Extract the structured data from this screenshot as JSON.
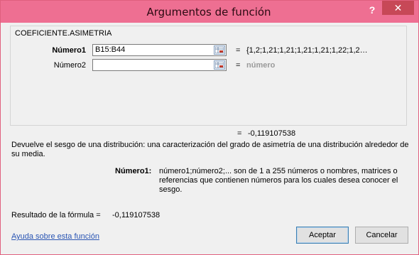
{
  "window": {
    "title": "Argumentos de función",
    "help_glyph": "?",
    "close_glyph": "✕"
  },
  "function": {
    "name": "COEFICIENTE.ASIMETRIA"
  },
  "args": [
    {
      "label": "Número1",
      "value": "B15:B44",
      "eq": "=",
      "preview": "{1,2;1,21;1,21;1,21;1,21;1,22;1,2…"
    },
    {
      "label": "Número2",
      "value": "",
      "eq": "=",
      "preview": "número"
    }
  ],
  "result": {
    "eq": "=",
    "value": "-0,119107538"
  },
  "description": "Devuelve el sesgo de una distribución: una caracterización del grado de asimetría de una distribución alrededor de su media.",
  "arg_help": {
    "label": "Número1:",
    "text": "número1;número2;... son de 1 a 255 números o nombres, matrices o referencias que contienen números para los cuales desea conocer el sesgo."
  },
  "formula_result": {
    "label": "Resultado de la fórmula =",
    "value": "-0,119107538"
  },
  "footer": {
    "help_link": "Ayuda sobre esta función",
    "ok": "Aceptar",
    "cancel": "Cancelar"
  },
  "colors": {
    "titlebar": "#ee6f92",
    "close": "#c74857",
    "link": "#2a55b3"
  }
}
